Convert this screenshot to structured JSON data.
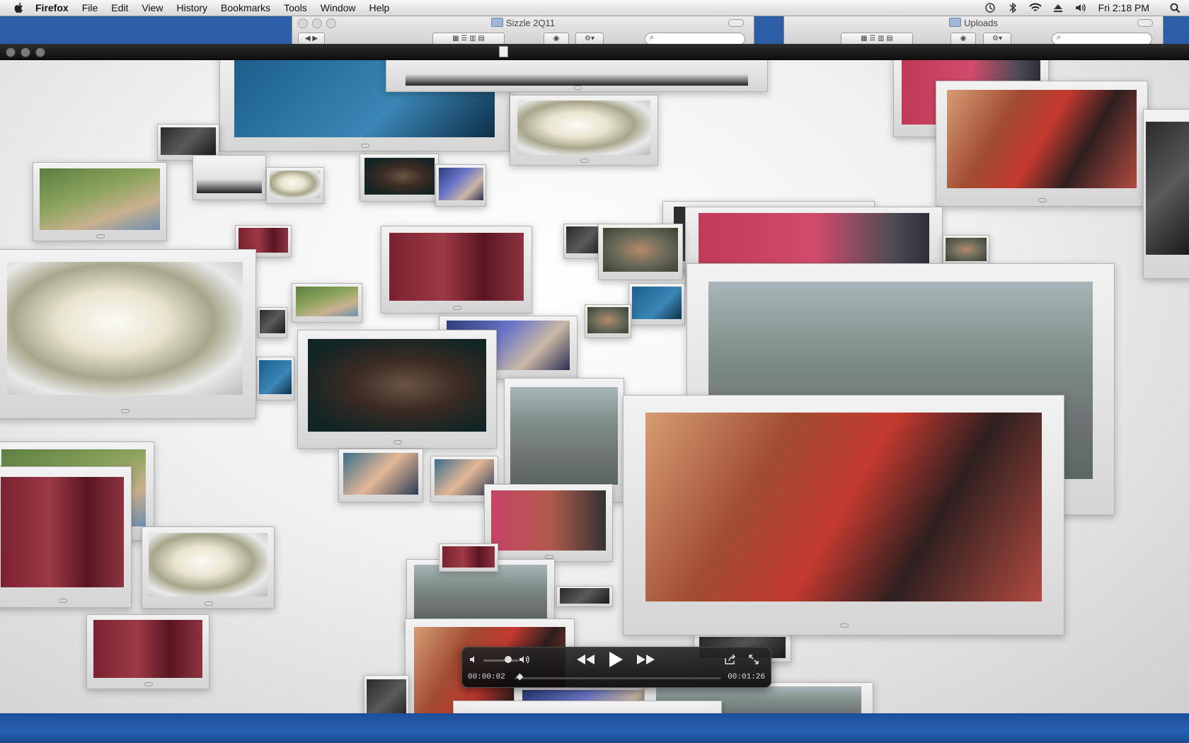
{
  "menubar": {
    "app_name": "Firefox",
    "items": [
      "File",
      "Edit",
      "View",
      "History",
      "Bookmarks",
      "Tools",
      "Window",
      "Help"
    ],
    "clock": "Fri 2:18 PM",
    "status_icons": [
      "time-machine-icon",
      "bluetooth-icon",
      "wifi-icon",
      "eject-icon",
      "volume-icon",
      "spotlight-icon"
    ]
  },
  "finder_windows": [
    {
      "title": "Sizzle 2Q11"
    },
    {
      "title": "Uploads"
    }
  ],
  "player": {
    "current_time": "00:00:02",
    "duration": "00:01:26",
    "progress": 0.023,
    "volume": 0.7
  }
}
